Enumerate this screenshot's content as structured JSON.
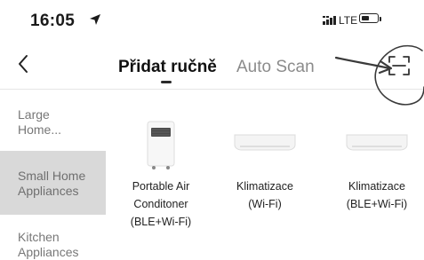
{
  "status_bar": {
    "time": "16:05",
    "network": "LTE",
    "battery_level": 0.55,
    "icons": [
      "location-arrow-icon",
      "signal-bars-icon",
      "battery-icon"
    ]
  },
  "nav": {
    "back_icon": "chevron-left-icon",
    "tabs": [
      {
        "label": "Přidat ručně",
        "active": true
      },
      {
        "label": "Auto Scan",
        "active": false
      }
    ],
    "scan_icon": "scan-frame-icon"
  },
  "sidebar": {
    "items": [
      {
        "label": "Large\nHome...",
        "active": false
      },
      {
        "label": "Small Home\nAppliances",
        "active": true
      },
      {
        "label": "Kitchen\nAppliances",
        "active": false
      }
    ]
  },
  "products": [
    {
      "name_lines": [
        "Portable Air",
        "Conditoner",
        "(BLE+Wi-Fi)"
      ],
      "icon": "portable-air-conditioner-icon"
    },
    {
      "name_lines": [
        "Klimatizace",
        "(Wi-Fi)"
      ],
      "icon": "wall-air-conditioner-icon"
    },
    {
      "name_lines": [
        "Klimatizace",
        "(BLE+Wi-Fi)"
      ],
      "icon": "wall-air-conditioner-icon"
    }
  ],
  "colors": {
    "sidebar_active_bg": "#d9d9d9",
    "tab_inactive": "#8b8b8b",
    "annotation": "#3a3a3a"
  }
}
